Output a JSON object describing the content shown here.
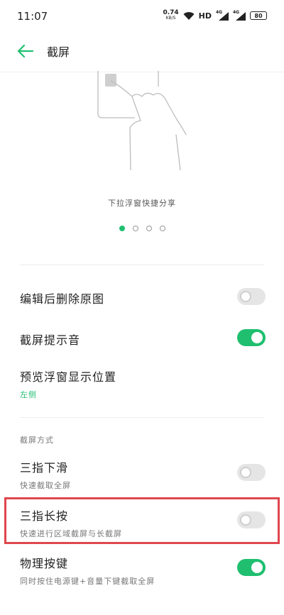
{
  "status_bar": {
    "time": "11:07",
    "net_speed": "0.74",
    "net_unit": "KB/S",
    "hd": "HD",
    "sig1": "4G",
    "sig2": "4G",
    "battery": "80"
  },
  "header": {
    "title": "截屏"
  },
  "illustration": {
    "caption": "下拉浮窗快捷分享",
    "pages": 4,
    "active_page": 1
  },
  "settings": {
    "delete_original": {
      "label": "编辑后删除原图",
      "enabled": false
    },
    "sound": {
      "label": "截屏提示音",
      "enabled": true
    },
    "preview_position": {
      "label": "预览浮窗显示位置",
      "value": "左侧"
    }
  },
  "methods": {
    "section_title": "截屏方式",
    "three_finger_swipe": {
      "label": "三指下滑",
      "sub": "快速截取全屏",
      "enabled": false
    },
    "three_finger_hold": {
      "label": "三指长按",
      "sub": "快速进行区域截屏与长截屏",
      "enabled": false
    },
    "physical_keys": {
      "label": "物理按键",
      "sub": "同时按住电源键+音量下键截取全屏",
      "enabled": true
    }
  },
  "colors": {
    "accent": "#1fbf6f",
    "highlight": "#e0464e"
  }
}
